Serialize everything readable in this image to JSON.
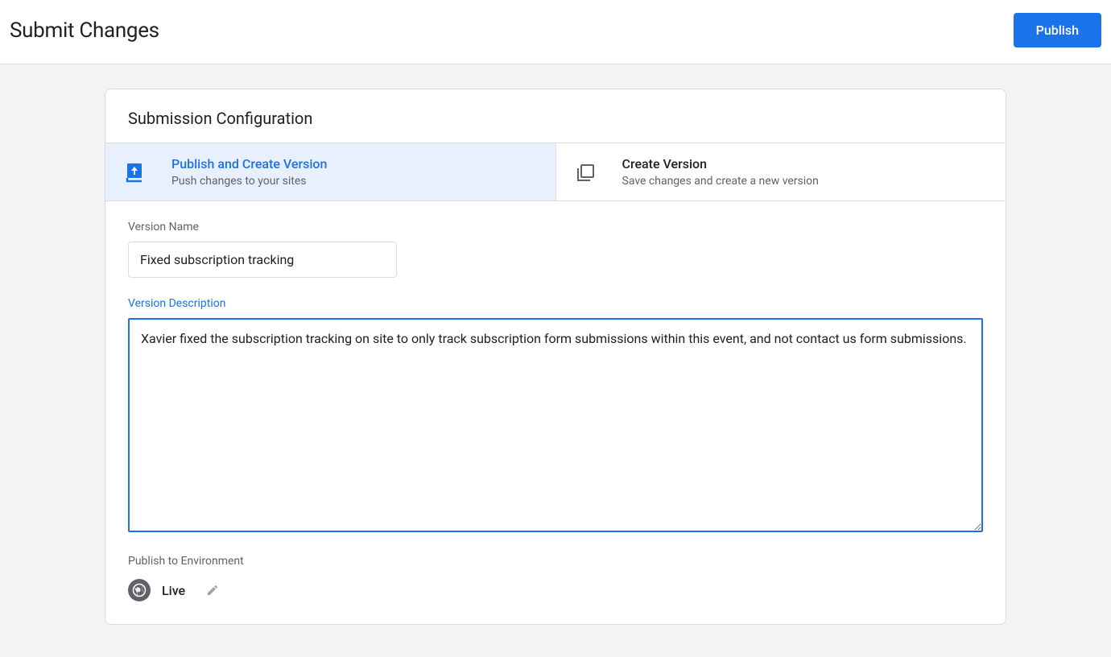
{
  "header": {
    "title": "Submit Changes",
    "publish_button": "Publish"
  },
  "card": {
    "title": "Submission Configuration",
    "tabs": [
      {
        "title": "Publish and Create Version",
        "subtitle": "Push changes to your sites"
      },
      {
        "title": "Create Version",
        "subtitle": "Save changes and create a new version"
      }
    ],
    "version_name_label": "Version Name",
    "version_name_value": "Fixed subscription tracking",
    "version_description_label": "Version Description",
    "version_description_value": "Xavier fixed the subscription tracking on site to only track subscription form submissions within this event, and not contact us form submissions.",
    "publish_env_label": "Publish to Environment",
    "env_name": "Live"
  }
}
